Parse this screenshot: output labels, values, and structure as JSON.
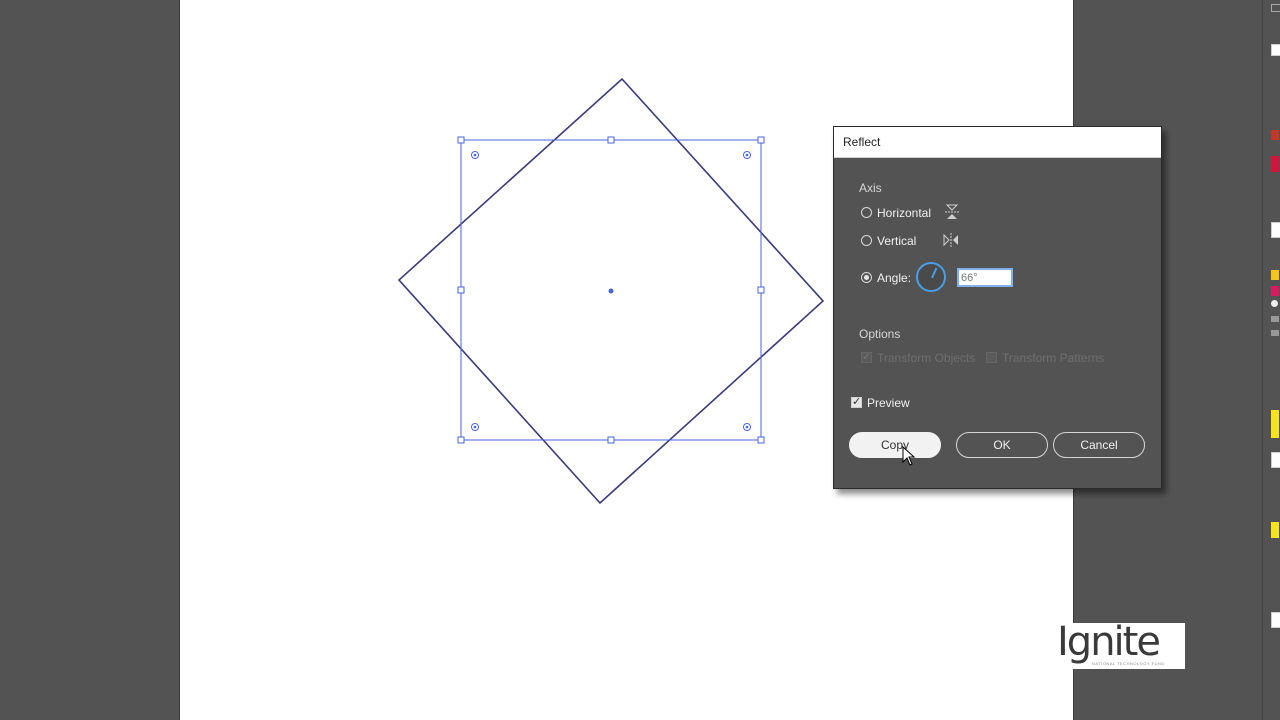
{
  "dialog": {
    "title": "Reflect",
    "axis_label": "Axis",
    "horizontal_label": "Horizontal",
    "vertical_label": "Vertical",
    "angle_label": "Angle:",
    "angle_value": "66°",
    "options_label": "Options",
    "transform_objects_label": "Transform Objects",
    "transform_patterns_label": "Transform Patterns",
    "preview_label": "Preview",
    "copy_label": "Copy",
    "ok_label": "OK",
    "cancel_label": "Cancel",
    "selected_axis": "angle",
    "preview_checked": true,
    "transform_objects_checked": true,
    "transform_patterns_checked": false
  },
  "logo": {
    "text": "Ignite",
    "subtext": "NATIONAL TECHNOLOGY FUND"
  },
  "colors": {
    "workspace": "#535353",
    "artboard": "#ffffff",
    "shape_stroke": "#3b3a7a",
    "selection": "#4a64d8",
    "accent": "#4a9de8",
    "logo_accent": "#f5a623"
  },
  "icons": {
    "horizontal_axis": "reflect-horizontal-icon",
    "vertical_axis": "reflect-vertical-icon",
    "angle_dial": "angle-dial-icon",
    "cursor": "mouse-pointer-icon"
  }
}
